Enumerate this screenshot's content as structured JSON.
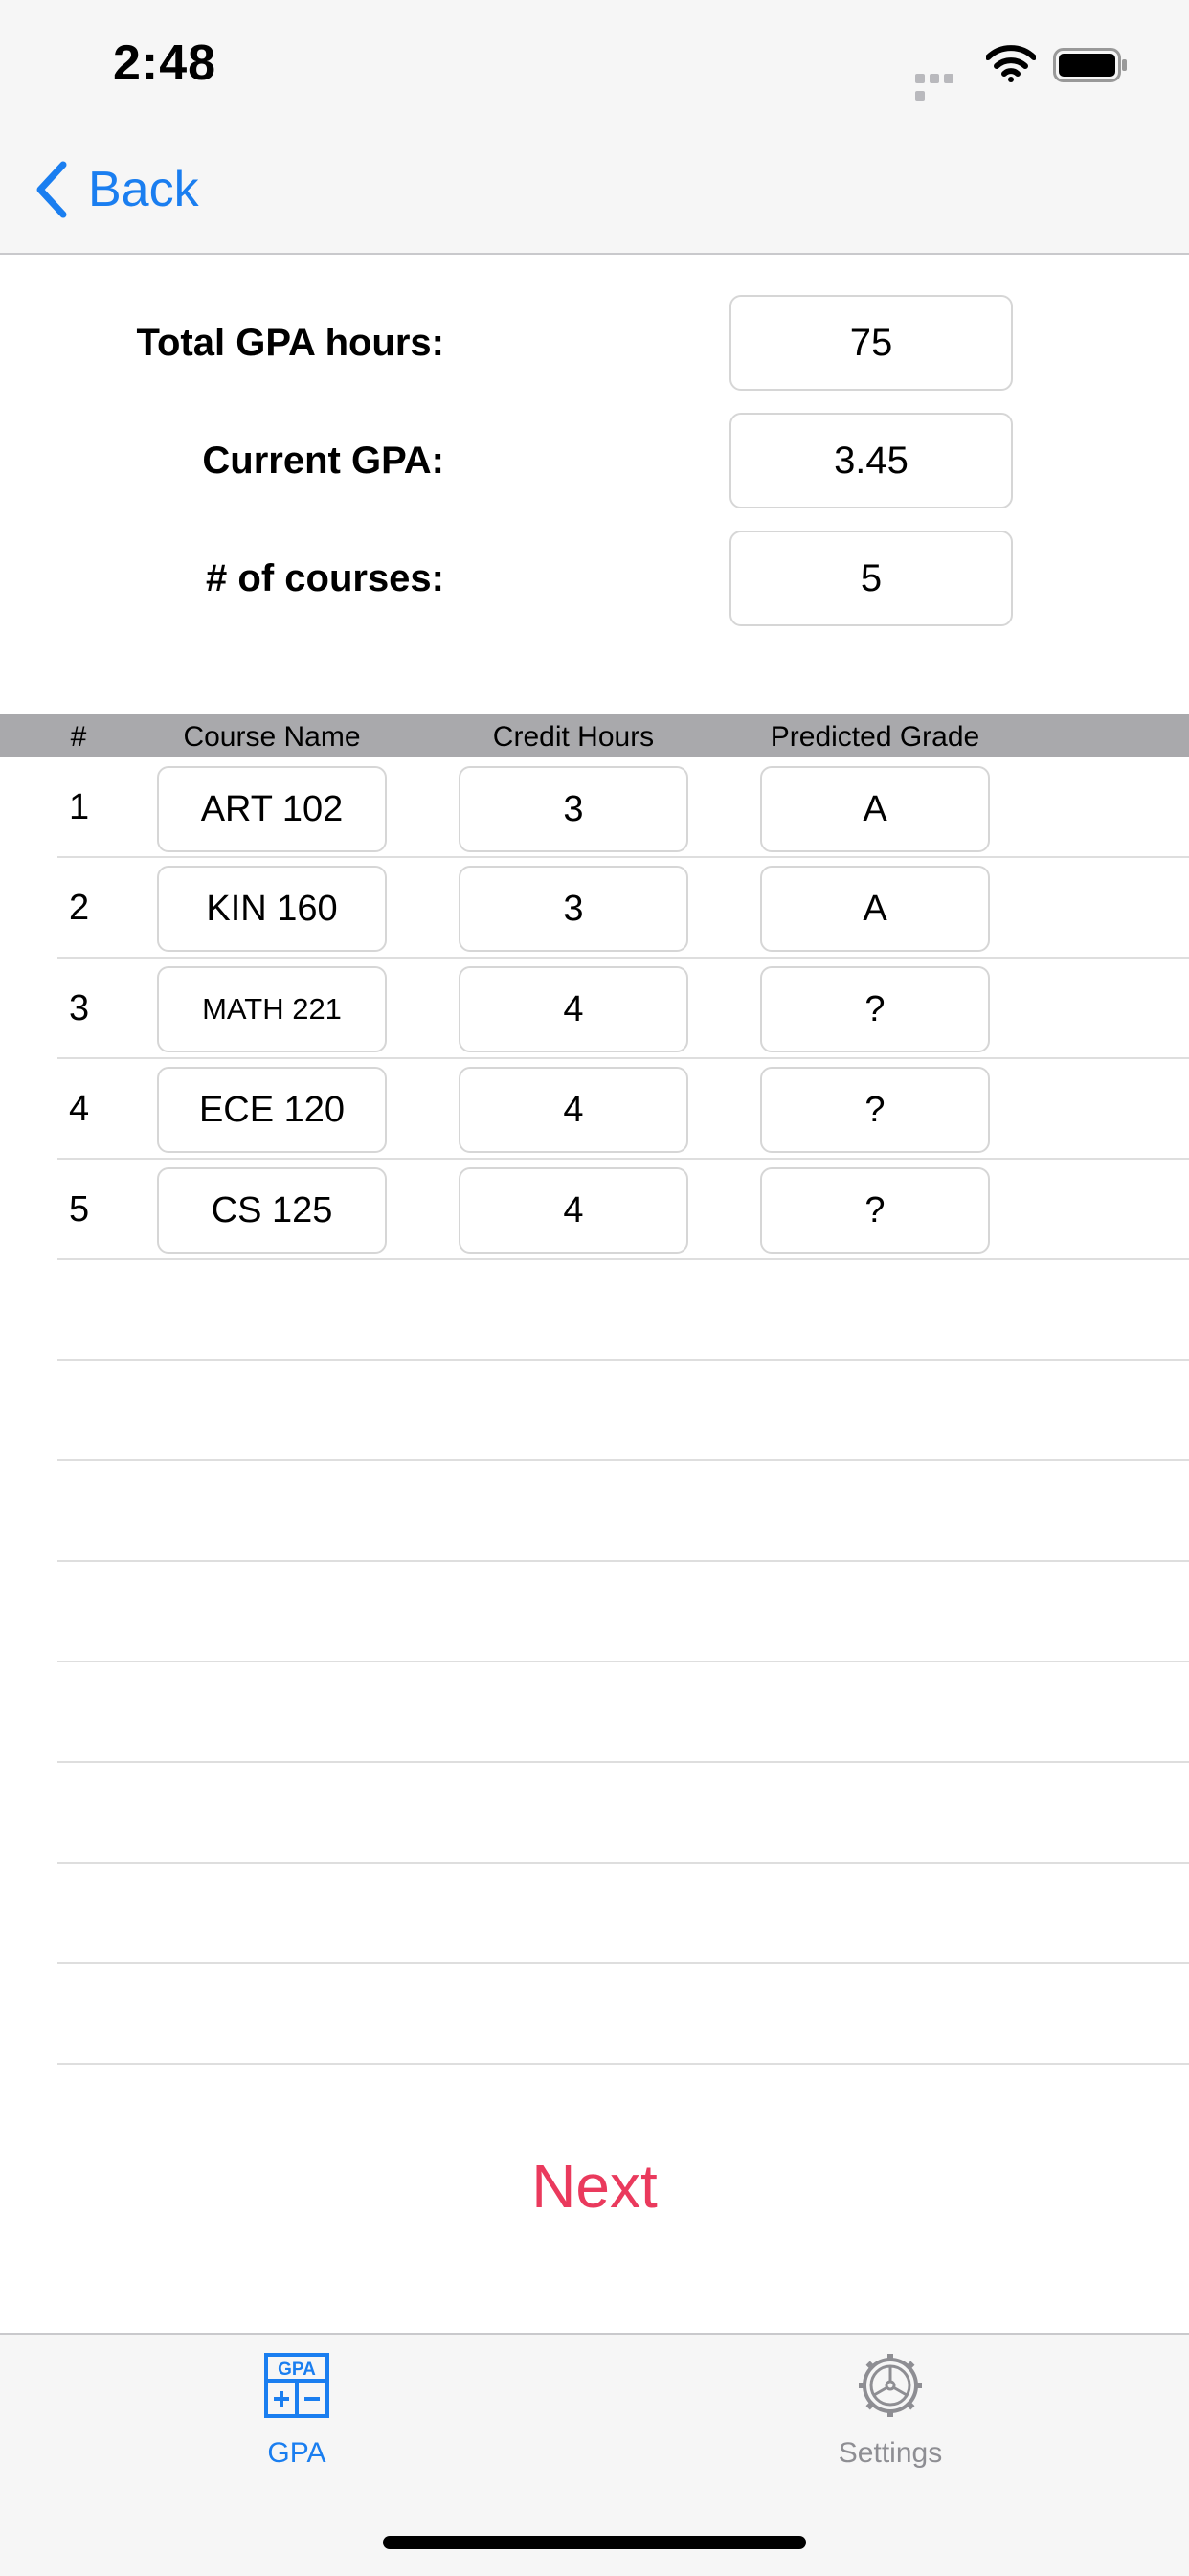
{
  "status_bar": {
    "time": "2:48"
  },
  "nav": {
    "back_label": "Back"
  },
  "summary": {
    "total_hours_label": "Total GPA hours:",
    "total_hours_value": "75",
    "current_gpa_label": "Current GPA:",
    "current_gpa_value": "3.45",
    "num_courses_label": "# of courses:",
    "num_courses_value": "5"
  },
  "table": {
    "headers": [
      "#",
      "Course Name",
      "Credit Hours",
      "Predicted Grade"
    ],
    "rows": [
      {
        "num": "1",
        "course": "ART 102",
        "hours": "3",
        "grade": "A"
      },
      {
        "num": "2",
        "course": "KIN 160",
        "hours": "3",
        "grade": "A"
      },
      {
        "num": "3",
        "course": "MATH 221",
        "hours": "4",
        "grade": "?"
      },
      {
        "num": "4",
        "course": "ECE 120",
        "hours": "4",
        "grade": "?"
      },
      {
        "num": "5",
        "course": "CS 125",
        "hours": "4",
        "grade": "?"
      }
    ]
  },
  "actions": {
    "next_label": "Next"
  },
  "tabbar": {
    "gpa_label": "GPA",
    "gpa_icon_text": "GPA",
    "settings_label": "Settings",
    "active_color": "#1a7ef0",
    "inactive_color": "#8e8e93"
  },
  "colors": {
    "accent": "#1a7ef0",
    "next": "#ea3a5d",
    "header_bg": "#a9a9ac"
  }
}
